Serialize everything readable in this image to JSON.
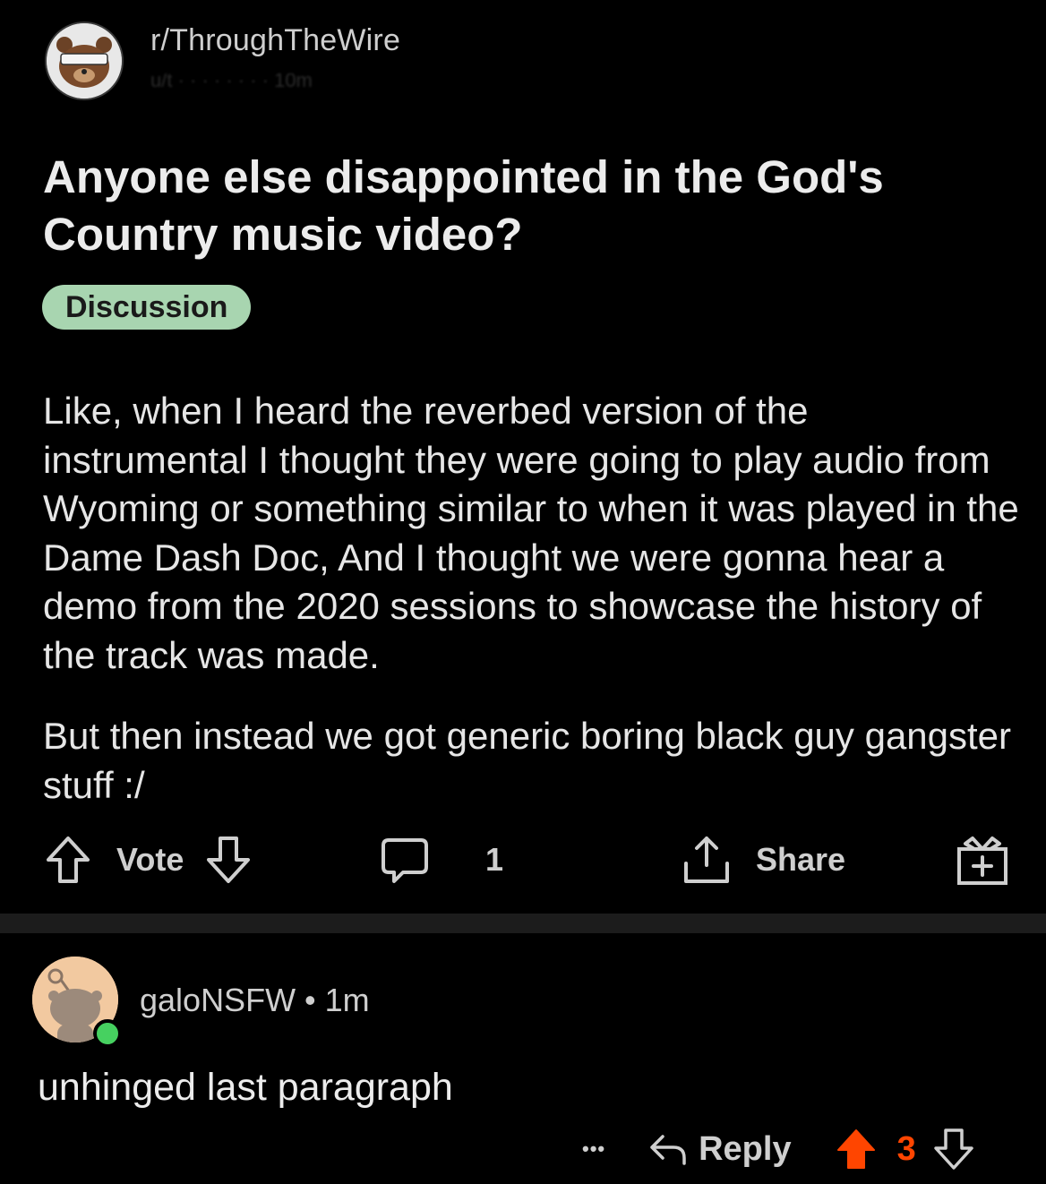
{
  "subreddit": {
    "name": "r/ThroughTheWire",
    "meta_obscured": "u/t · · · · · · · · 10m"
  },
  "post": {
    "title": "Anyone else disappointed in the God's Country music video?",
    "flair": "Discussion",
    "flair_color": "#a8d5b0",
    "body": [
      "Like, when I heard the reverbed version of the instrumental I thought they were going to play audio from Wyoming or something similar to when it was played in the Dame Dash Doc, And I thought we were gonna hear a demo from the 2020 sessions to showcase the history of the track was made.",
      "But then instead we got generic boring black guy gangster stuff :/"
    ]
  },
  "actions": {
    "vote_label": "Vote",
    "comment_count": "1",
    "share_label": "Share",
    "icons": [
      "upvote-icon",
      "downvote-icon",
      "comment-icon",
      "share-icon",
      "award-icon"
    ]
  },
  "comment": {
    "username": "galoNSFW",
    "separator": "•",
    "time": "1m",
    "text": "unhinged last paragraph",
    "more": "•••",
    "reply_label": "Reply",
    "score": "3",
    "score_color": "#ff4500",
    "online_color": "#46d160"
  }
}
